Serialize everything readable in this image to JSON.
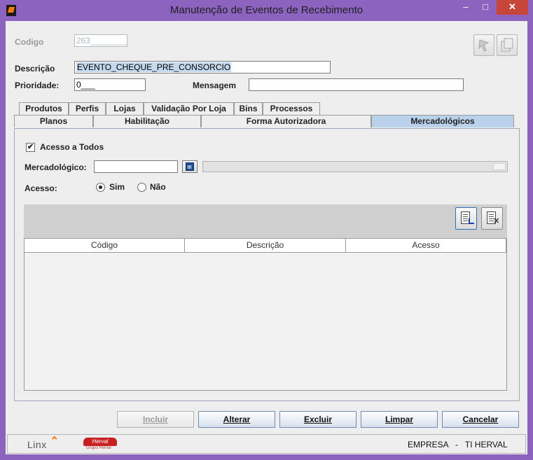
{
  "window": {
    "title": "Manutenção de Eventos de Recebimento",
    "minimize": "–",
    "maximize": "□",
    "close": "✕"
  },
  "form": {
    "codigo_label": "Codigo",
    "codigo_value": "263________",
    "descricao_label": "Descrição",
    "descricao_value": "EVENTO_CHEQUE_PRE_CONSORCIO",
    "prioridade_label": "Prioridade:",
    "prioridade_value": "0___",
    "mensagem_label": "Mensagem",
    "mensagem_value": ""
  },
  "tabs_row1": [
    "Produtos",
    "Perfis",
    "Lojas",
    "Validação Por Loja",
    "Bins",
    "Processos"
  ],
  "tabs_row2": [
    "Planos",
    "Habilitação",
    "Forma Autorizadora",
    "Mercadológicos"
  ],
  "active_tab": "Mercadológicos",
  "panel": {
    "acesso_todos_label": "Acesso a Todos",
    "acesso_todos_checked": true,
    "check_mark": "✔",
    "mercadologico_label": "Mercadológico:",
    "mercadologico_value": "",
    "acesso_label": "Acesso:",
    "sim_label": "Sim",
    "nao_label": "Não",
    "acesso_selected": "Sim"
  },
  "grid": {
    "columns": [
      "Código",
      "Descrição",
      "Acesso"
    ],
    "rows": []
  },
  "buttons": {
    "incluir": "Incluir",
    "alterar": "Alterar",
    "excluir": "Excluir",
    "limpar": "Limpar",
    "cancelar": "Cancelar"
  },
  "footer": {
    "linx": "Linx",
    "herval": "Herval",
    "herval_sub": "Grupo Herval",
    "empresa": "EMPRESA   -   TI HERVAL"
  }
}
